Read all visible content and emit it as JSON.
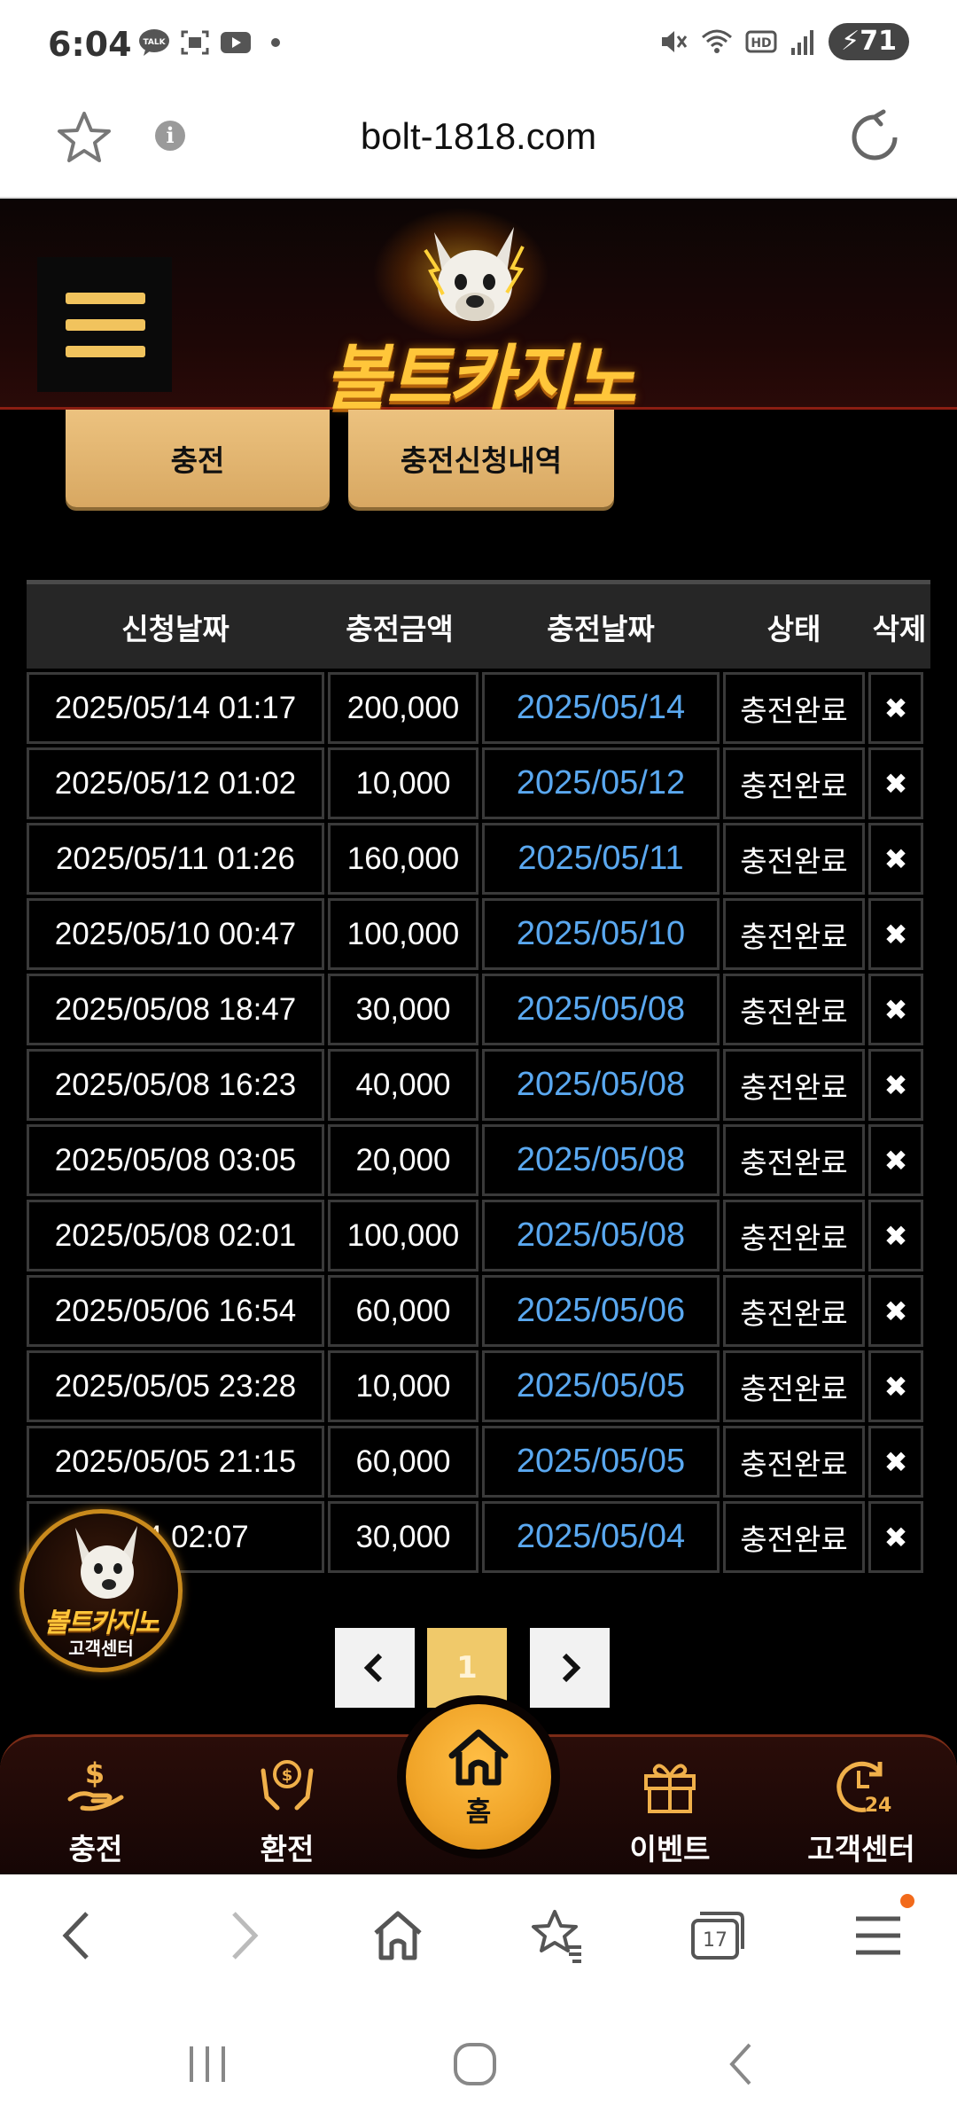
{
  "status_bar": {
    "time": "6:04",
    "battery": "71",
    "icons_left": [
      "talk-icon",
      "screenshot-icon",
      "youtube-icon"
    ],
    "icons_right": [
      "mute-icon",
      "wifi-icon",
      "hd-icon",
      "signal-icon"
    ]
  },
  "browser": {
    "url": "bolt-1818.com",
    "tab_count": "17"
  },
  "site": {
    "logo_text": "볼트카지노",
    "tabs": [
      {
        "label": "충전"
      },
      {
        "label": "충전신청내역"
      }
    ]
  },
  "table": {
    "headers": [
      "신청날짜",
      "충전금액",
      "충전날짜",
      "상태",
      "삭제"
    ],
    "rows": [
      {
        "request_date": "2025/05/14 01:17",
        "amount": "200,000",
        "charge_date": "2025/05/14",
        "status": "충전완료"
      },
      {
        "request_date": "2025/05/12 01:02",
        "amount": "10,000",
        "charge_date": "2025/05/12",
        "status": "충전완료"
      },
      {
        "request_date": "2025/05/11 01:26",
        "amount": "160,000",
        "charge_date": "2025/05/11",
        "status": "충전완료"
      },
      {
        "request_date": "2025/05/10 00:47",
        "amount": "100,000",
        "charge_date": "2025/05/10",
        "status": "충전완료"
      },
      {
        "request_date": "2025/05/08 18:47",
        "amount": "30,000",
        "charge_date": "2025/05/08",
        "status": "충전완료"
      },
      {
        "request_date": "2025/05/08 16:23",
        "amount": "40,000",
        "charge_date": "2025/05/08",
        "status": "충전완료"
      },
      {
        "request_date": "2025/05/08 03:05",
        "amount": "20,000",
        "charge_date": "2025/05/08",
        "status": "충전완료"
      },
      {
        "request_date": "2025/05/08 02:01",
        "amount": "100,000",
        "charge_date": "2025/05/08",
        "status": "충전완료"
      },
      {
        "request_date": "2025/05/06 16:54",
        "amount": "60,000",
        "charge_date": "2025/05/06",
        "status": "충전완료"
      },
      {
        "request_date": "2025/05/05 23:28",
        "amount": "10,000",
        "charge_date": "2025/05/05",
        "status": "충전완료"
      },
      {
        "request_date": "2025/05/05 21:15",
        "amount": "60,000",
        "charge_date": "2025/05/05",
        "status": "충전완료"
      },
      {
        "request_date": "5/04 02:07",
        "amount": "30,000",
        "charge_date": "2025/05/04",
        "status": "충전완료"
      }
    ],
    "delete_glyph": "✖"
  },
  "support_badge": {
    "title": "볼트카지노",
    "subtitle": "고객센터"
  },
  "pagination": {
    "current": "1"
  },
  "bottom_nav": {
    "items": [
      {
        "label": "충전"
      },
      {
        "label": "환전"
      },
      {
        "label": "홈"
      },
      {
        "label": "이벤트"
      },
      {
        "label": "고객센터"
      }
    ]
  },
  "colors": {
    "gold": "#ecc27f",
    "link_blue": "#5aa8f0",
    "home_orange": "#f0a428"
  }
}
